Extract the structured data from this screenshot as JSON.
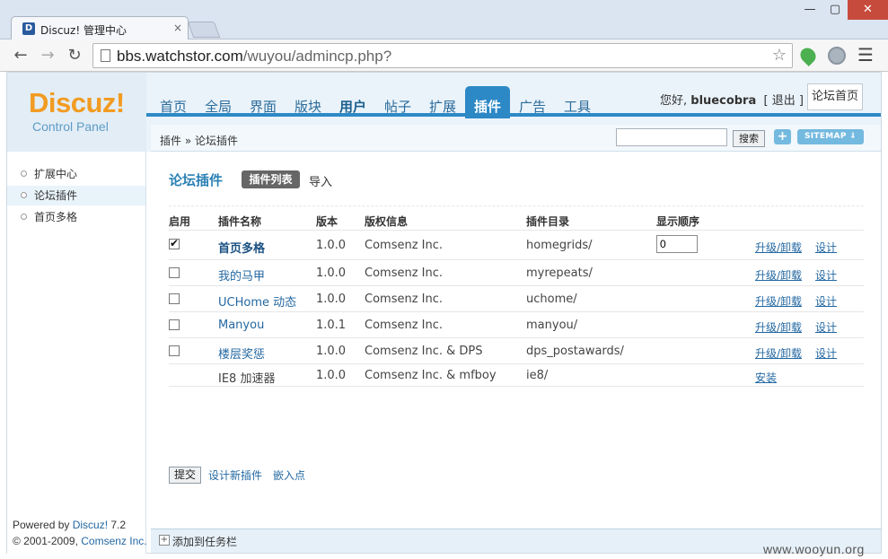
{
  "browser": {
    "tab_title": "Discuz! 管理中心",
    "tab_close": "×",
    "win_min": "—",
    "win_max": "▢",
    "win_close": "✕",
    "url_host": "bbs.watchstor.com",
    "url_path": "/wuyou/admincp.php?"
  },
  "logo": {
    "brand": "Discuz!",
    "sub": "Control Panel"
  },
  "nav": {
    "items": [
      "首页",
      "全局",
      "界面",
      "版块",
      "用户",
      "帖子",
      "扩展",
      "插件",
      "广告",
      "工具"
    ],
    "active": "插件"
  },
  "user": {
    "greeting": "您好,",
    "name": "bluecobra",
    "logout": "[ 退出 ]",
    "forum_home": "论坛首页"
  },
  "subbar": {
    "breadcrumb": "插件 » 论坛插件",
    "search_button": "搜索",
    "plus": "+",
    "sitemap": "SITEMAP ⇓"
  },
  "sidebar": {
    "items": [
      "扩展中心",
      "论坛插件",
      "首页多格"
    ],
    "active": "论坛插件",
    "footer": {
      "powered_prefix": "Powered by ",
      "powered_link": "Discuz!",
      "version": " 7.2",
      "copyright_prefix": "© 2001-2009, ",
      "company": "Comsenz Inc."
    }
  },
  "content": {
    "section_title": "论坛插件",
    "tab_active": "插件列表",
    "tab_import": "导入",
    "columns": [
      "启用",
      "插件名称",
      "版本",
      "版权信息",
      "插件目录",
      "显示顺序"
    ],
    "rows": [
      {
        "enabled": true,
        "name": "首页多格",
        "version": "1.0.0",
        "copyright": "Comsenz Inc.",
        "dir": "homegrids/",
        "order": "0",
        "action1": "升级/卸载",
        "action2": "设计"
      },
      {
        "enabled": false,
        "name": "我的马甲",
        "version": "1.0.0",
        "copyright": "Comsenz Inc.",
        "dir": "myrepeats/",
        "action1": "升级/卸载",
        "action2": "设计"
      },
      {
        "enabled": false,
        "name": "UCHome 动态",
        "version": "1.0.0",
        "copyright": "Comsenz Inc.",
        "dir": "uchome/",
        "action1": "升级/卸载",
        "action2": "设计"
      },
      {
        "enabled": false,
        "name": "Manyou",
        "version": "1.0.1",
        "copyright": "Comsenz Inc.",
        "dir": "manyou/",
        "action1": "升级/卸载",
        "action2": "设计"
      },
      {
        "enabled": false,
        "name": "楼层奖惩",
        "version": "1.0.0",
        "copyright": "Comsenz Inc. & DPS",
        "dir": "dps_postawards/",
        "action1": "升级/卸载",
        "action2": "设计"
      },
      {
        "name": "IE8 加速器",
        "version": "1.0.0",
        "copyright": "Comsenz Inc. & mfboy",
        "dir": "ie8/",
        "action1": "安装"
      }
    ],
    "submit": "提交",
    "design_new": "设计新插件",
    "hook_points": "嵌入点"
  },
  "taskbar": {
    "icon": "+",
    "label": "添加到任务栏"
  },
  "watermark": "www.wooyun.org",
  "colors": {
    "accent": "#2d89c6",
    "logo": "#f29b22",
    "link": "#2468a2"
  }
}
